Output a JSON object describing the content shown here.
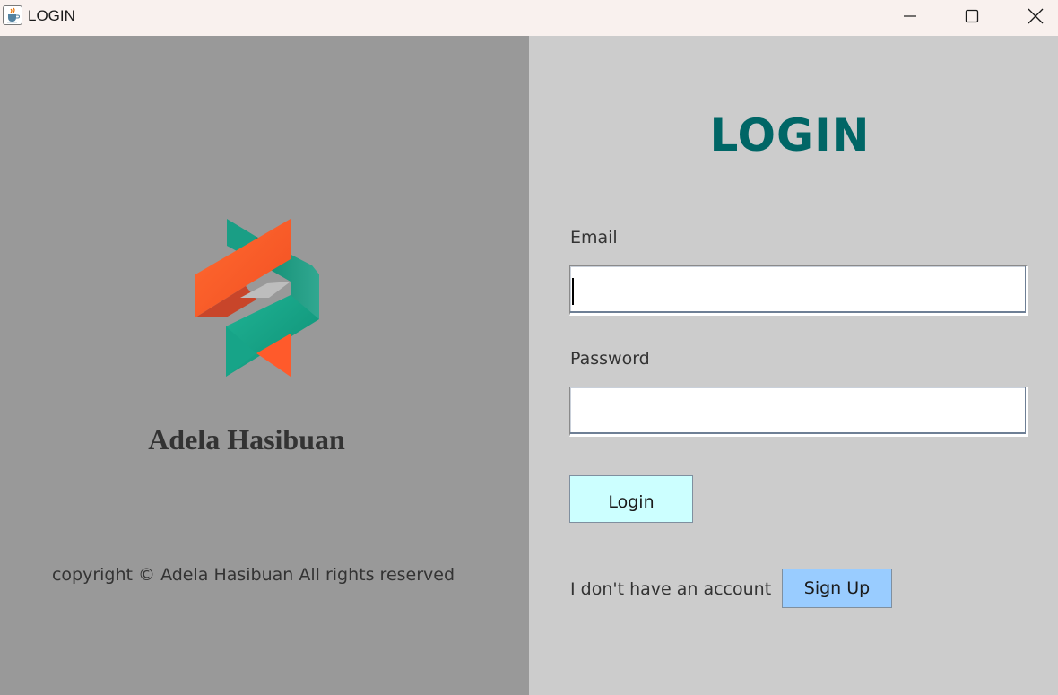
{
  "window": {
    "title": "LOGIN",
    "icon": "java-cup-icon",
    "controls": [
      "minimize-icon",
      "maximize-icon",
      "close-icon"
    ]
  },
  "left_panel": {
    "logo": "ribbon-logo",
    "brand_name": "Adela Hasibuan",
    "copyright": "copyright © Adela Hasibuan All rights reserved",
    "background": "#999999"
  },
  "right_panel": {
    "heading": "LOGIN",
    "heading_color": "#006666",
    "email": {
      "label": "Email",
      "value": ""
    },
    "password": {
      "label": "Password",
      "value": ""
    },
    "login_button": {
      "label": "Login",
      "color": "#ccffff"
    },
    "no_account_text": "I don't have an account",
    "signup_button": {
      "label": "Sign Up",
      "color": "#99ccff"
    },
    "background": "#cccccc"
  },
  "colors": {
    "logo_orange": "#ff5a2b",
    "logo_teal": "#16a88a"
  }
}
